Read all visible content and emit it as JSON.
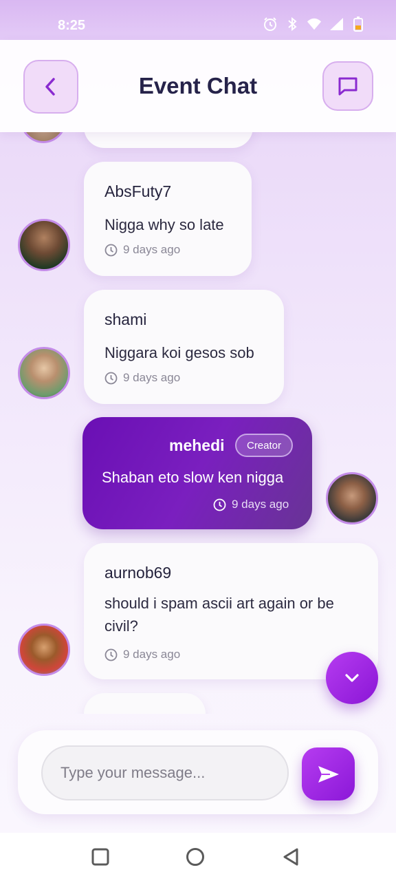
{
  "status_bar": {
    "time": "8:25",
    "icons": [
      "alarm-icon",
      "bluetooth-icon",
      "wifi-icon",
      "signal-icon",
      "battery-icon"
    ]
  },
  "header": {
    "title": "Event Chat",
    "back_icon": "chevron-left-icon",
    "action_icon": "chat-bubble-icon"
  },
  "messages": [
    {
      "author": "AbsFuty7",
      "text": "Nigga why so late",
      "time": "9 days ago",
      "mine": false
    },
    {
      "author": "shami",
      "text": "Niggara koi gesos sob",
      "time": "9 days ago",
      "mine": false
    },
    {
      "author": "mehedi",
      "badge": "Creator",
      "text": "Shaban eto slow ken nigga",
      "time": "9 days ago",
      "mine": true
    },
    {
      "author": "aurnob69",
      "text_line1": "should i spam ascii art again or be",
      "text_line2": "civil?",
      "time": "9 days ago",
      "mine": false
    }
  ],
  "composer": {
    "placeholder": "Type your message...",
    "send_icon": "send-icon"
  },
  "fab_icon": "chevron-down-icon",
  "colors": {
    "accent": "#9a22e0",
    "own_bubble": "#6e14b8",
    "title": "#26234a"
  }
}
